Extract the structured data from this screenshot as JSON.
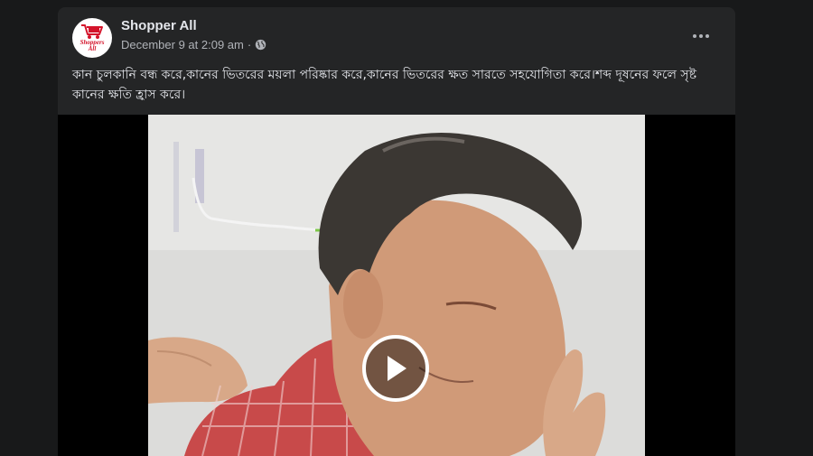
{
  "post": {
    "page_name": "Shopper All",
    "timestamp": "December 9 at 2:09 am",
    "separator": "·",
    "privacy_icon": "globe-icon",
    "avatar_text_line1": "Shoppers",
    "avatar_text_line2": "All",
    "more_icon": "more-horizontal-icon",
    "caption": "কান চুলকানি বন্ধ করে,কানের ভিতরের ময়লা পরিষ্কার করে,কানের ভিতরের ক্ষত সারতে সহযোগিতা করে।শব্দ দূষনের ফলে সৃষ্ট কানের ক্ষতি হ্রাস করে।"
  },
  "video": {
    "play_icon": "play-icon"
  },
  "colors": {
    "background": "#18191a",
    "card": "#242526",
    "primary_text": "#e4e6eb",
    "secondary_text": "#b0b3b8",
    "brand_red": "#d4142b"
  }
}
